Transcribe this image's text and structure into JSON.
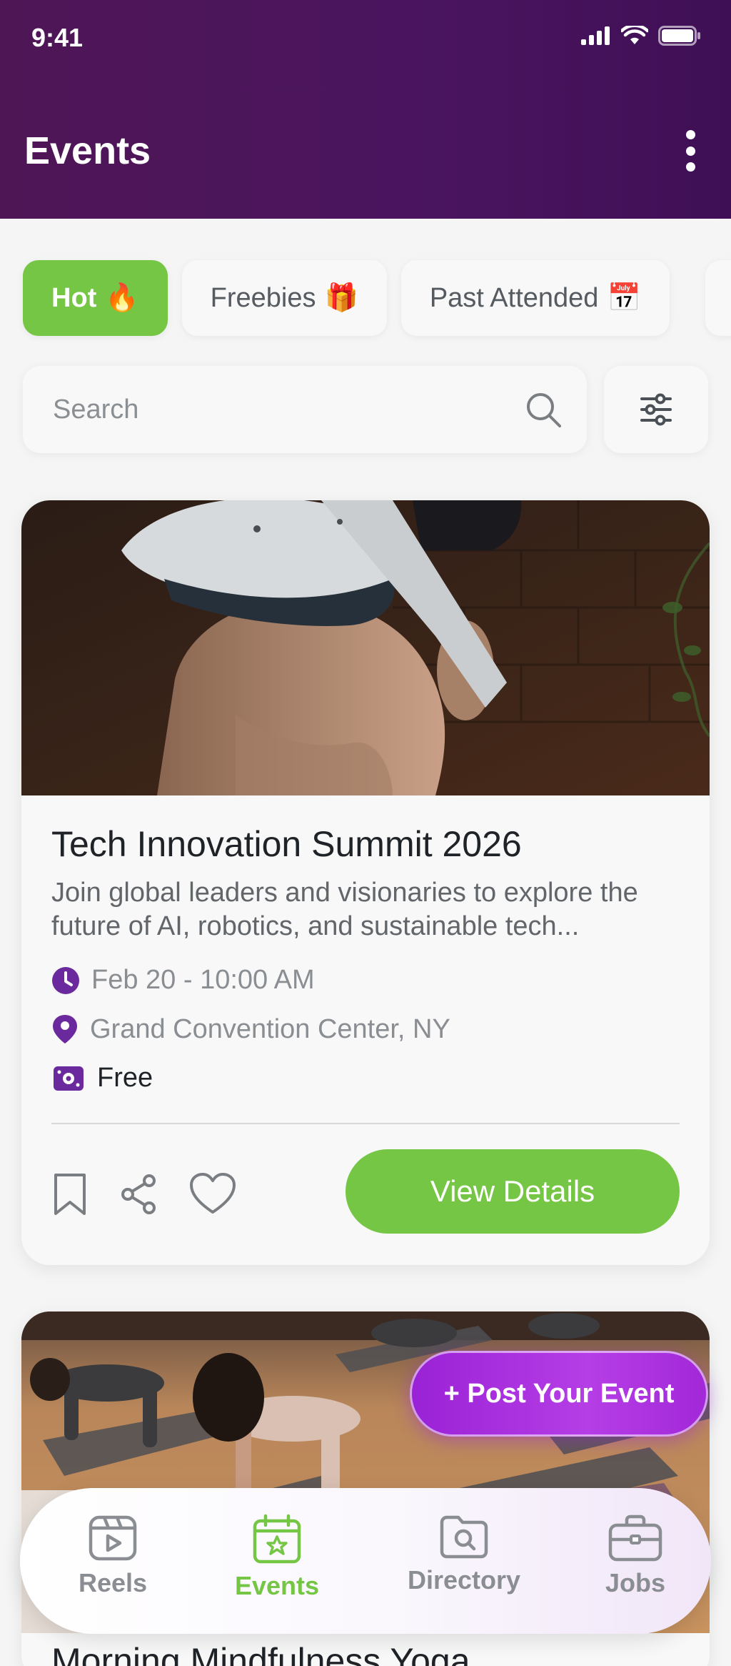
{
  "status_bar": {
    "time": "9:41"
  },
  "header": {
    "title": "Events"
  },
  "filter_chips": [
    {
      "label": "Hot",
      "emoji": "🔥",
      "active": true
    },
    {
      "label": "Freebies",
      "emoji": "🎁",
      "active": false
    },
    {
      "label": "Past Attended",
      "emoji": "📅",
      "active": false
    }
  ],
  "search": {
    "placeholder": "Search"
  },
  "events": [
    {
      "title": "Tech Innovation Summit 2026",
      "description": "Join global leaders and visionaries to explore the future of AI, robotics, and sustainable tech...",
      "datetime": "Feb 20 - 10:00 AM",
      "location": "Grand Convention Center, NY",
      "price": "Free",
      "cta": "View Details"
    },
    {
      "title": "Morning Mindfulness Yoga"
    }
  ],
  "fab": {
    "label": "+ Post Your Event"
  },
  "bottom_nav": [
    {
      "label": "Reels",
      "icon": "reels-icon",
      "active": false
    },
    {
      "label": "Events",
      "icon": "calendar-star-icon",
      "active": true
    },
    {
      "label": "Directory",
      "icon": "directory-search-icon",
      "active": false
    },
    {
      "label": "Jobs",
      "icon": "briefcase-icon",
      "active": false
    }
  ],
  "colors": {
    "header": "#4a155f",
    "accent_green": "#76c646",
    "accent_purple": "#6a2a9e",
    "fab_purple": "#b03ee3"
  }
}
